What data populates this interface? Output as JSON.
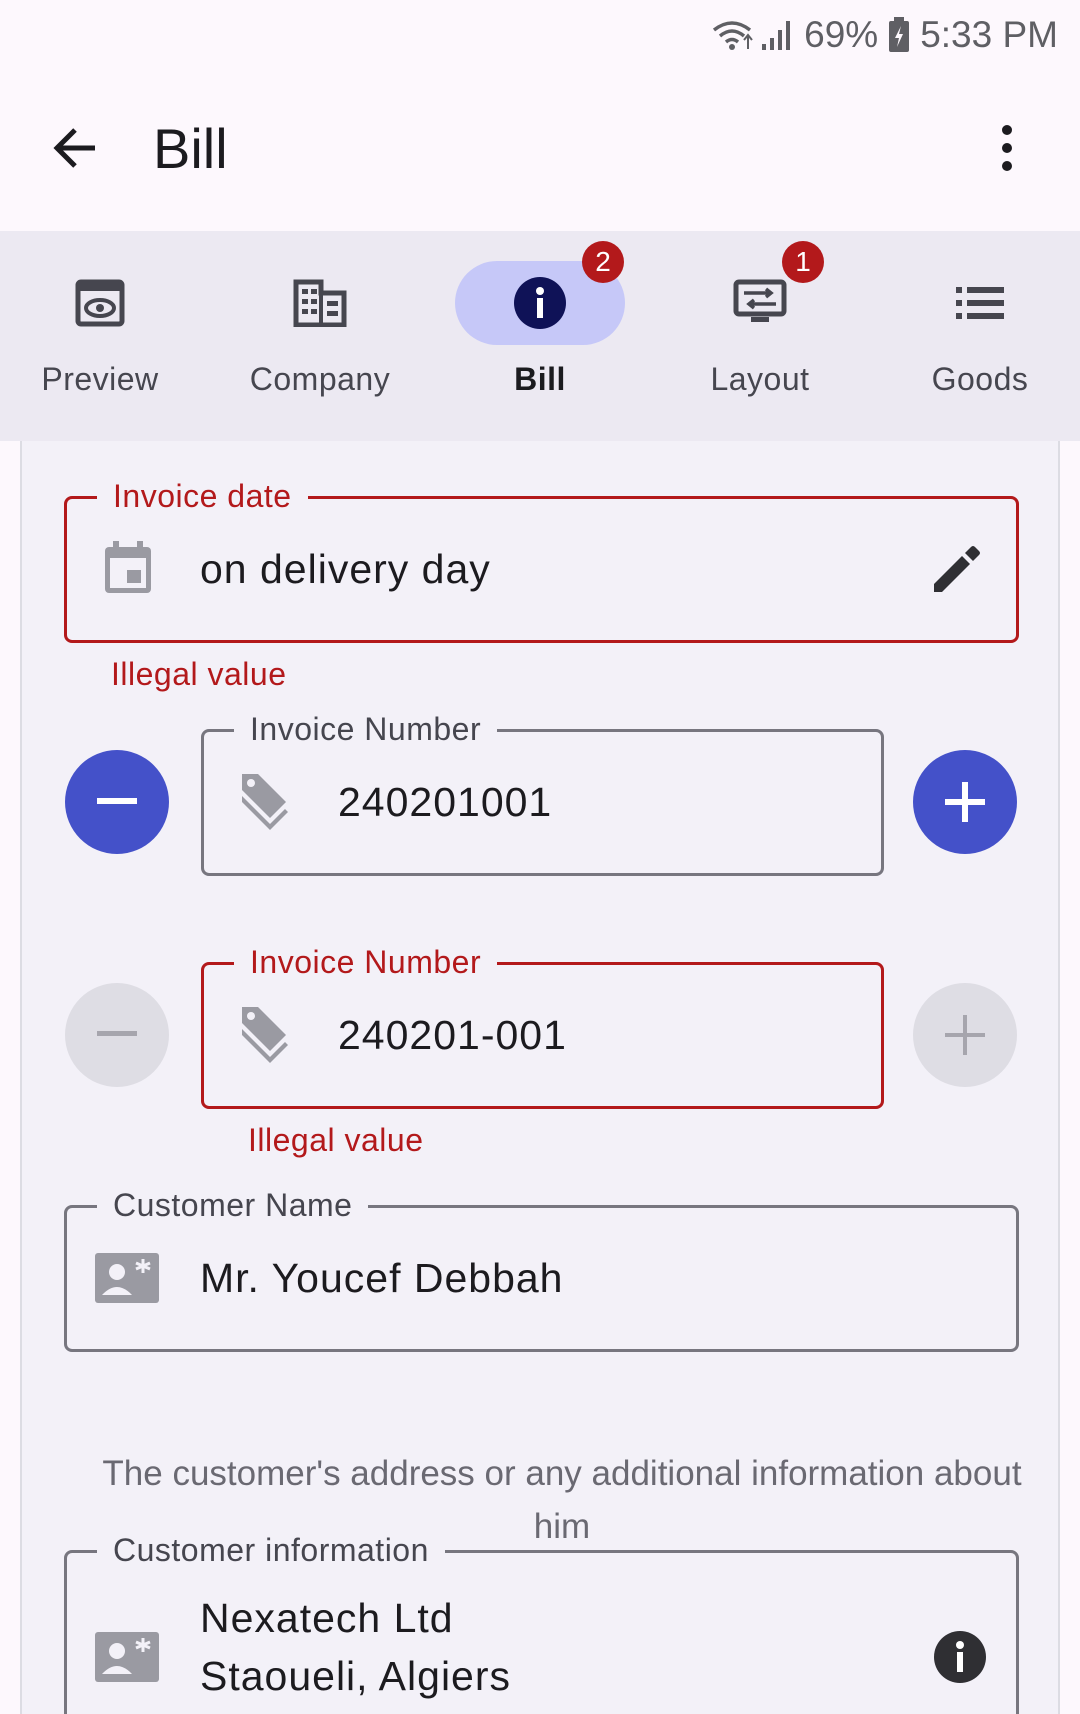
{
  "status_bar": {
    "battery": "69%",
    "time": "5:33 PM"
  },
  "app_bar": {
    "title": "Bill"
  },
  "tabs": [
    {
      "label": "Preview",
      "icon": "preview-icon"
    },
    {
      "label": "Company",
      "icon": "company-icon"
    },
    {
      "label": "Bill",
      "icon": "info-icon",
      "badge": "2",
      "active": true
    },
    {
      "label": "Layout",
      "icon": "layout-icon",
      "badge": "1"
    },
    {
      "label": "Goods",
      "icon": "list-icon"
    }
  ],
  "form": {
    "invoice_date": {
      "label": "Invoice date",
      "value": "on delivery day",
      "error": "Illegal value"
    },
    "invoice_number_1": {
      "label": "Invoice Number",
      "value": "240201001"
    },
    "invoice_number_2": {
      "label": "Invoice Number",
      "value": "240201-001",
      "error": "Illegal value"
    },
    "customer_name": {
      "label": "Customer Name",
      "value": "Mr. Youcef Debbah"
    },
    "customer_helper": "The customer's address or any additional information about him",
    "customer_info": {
      "label": "Customer information",
      "line1": "Nexatech Ltd",
      "line2": "Staoueli, Algiers"
    }
  },
  "colors": {
    "accent": "#4451c9",
    "error": "#b3191b",
    "tab_active_bg": "#c6c8f8",
    "tab_bar_bg": "#ece9f2"
  }
}
